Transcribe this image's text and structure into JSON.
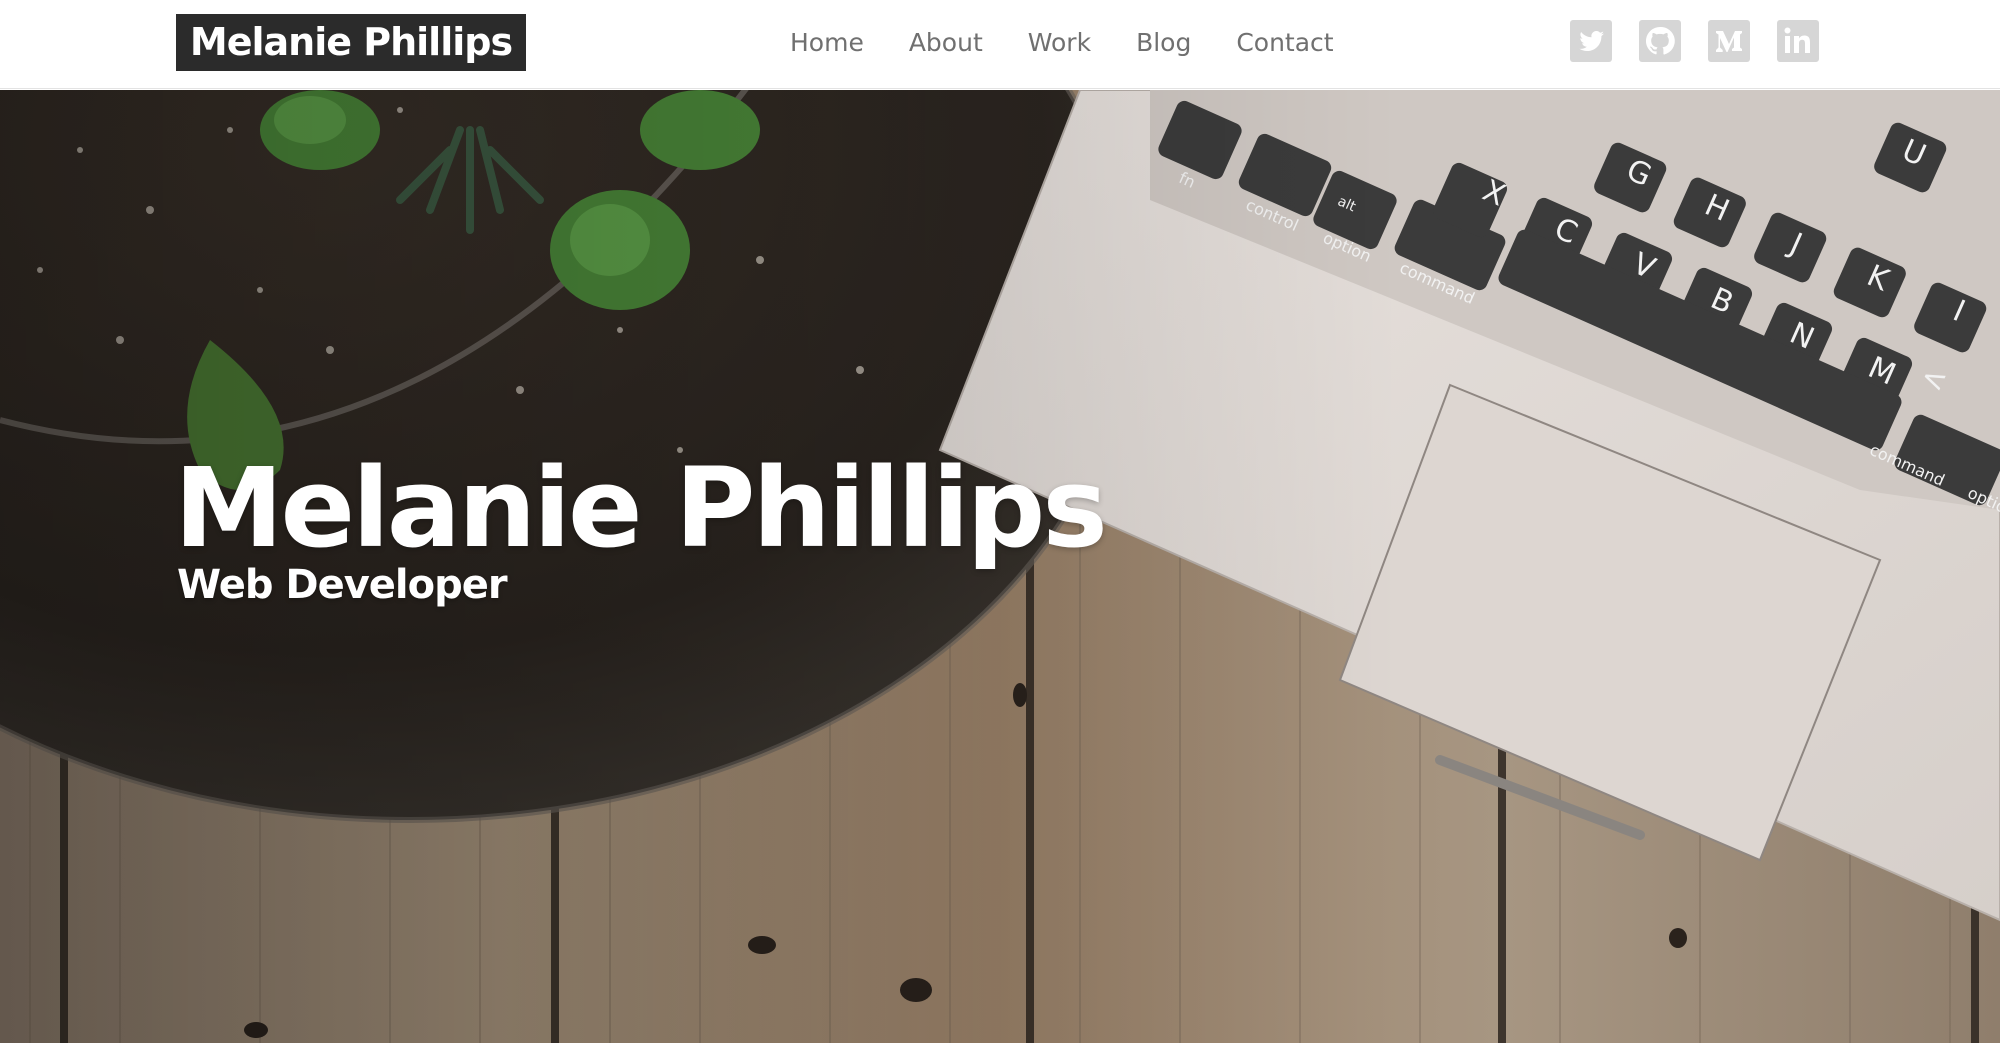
{
  "header": {
    "logo_text": "Melanie Phillips",
    "nav": [
      {
        "label": "Home"
      },
      {
        "label": "About"
      },
      {
        "label": "Work"
      },
      {
        "label": "Blog"
      },
      {
        "label": "Contact"
      }
    ],
    "social": [
      {
        "icon": "twitter-icon"
      },
      {
        "icon": "github-icon"
      },
      {
        "icon": "medium-icon"
      },
      {
        "icon": "linkedin-icon"
      }
    ]
  },
  "hero": {
    "title": "Melanie Phillips",
    "subtitle": "Web Developer",
    "keys": [
      "fn",
      "control",
      "alt",
      "option",
      "command",
      "X",
      "C",
      "V",
      "B",
      "N",
      "M",
      "G",
      "H",
      "J",
      "K",
      "U",
      "I",
      "<",
      "command",
      "optio"
    ]
  },
  "colors": {
    "logo_bg": "#2b2b2b",
    "nav_text": "#707070",
    "social_icon_bg": "#d6d6d6",
    "hero_text": "#ffffff"
  }
}
